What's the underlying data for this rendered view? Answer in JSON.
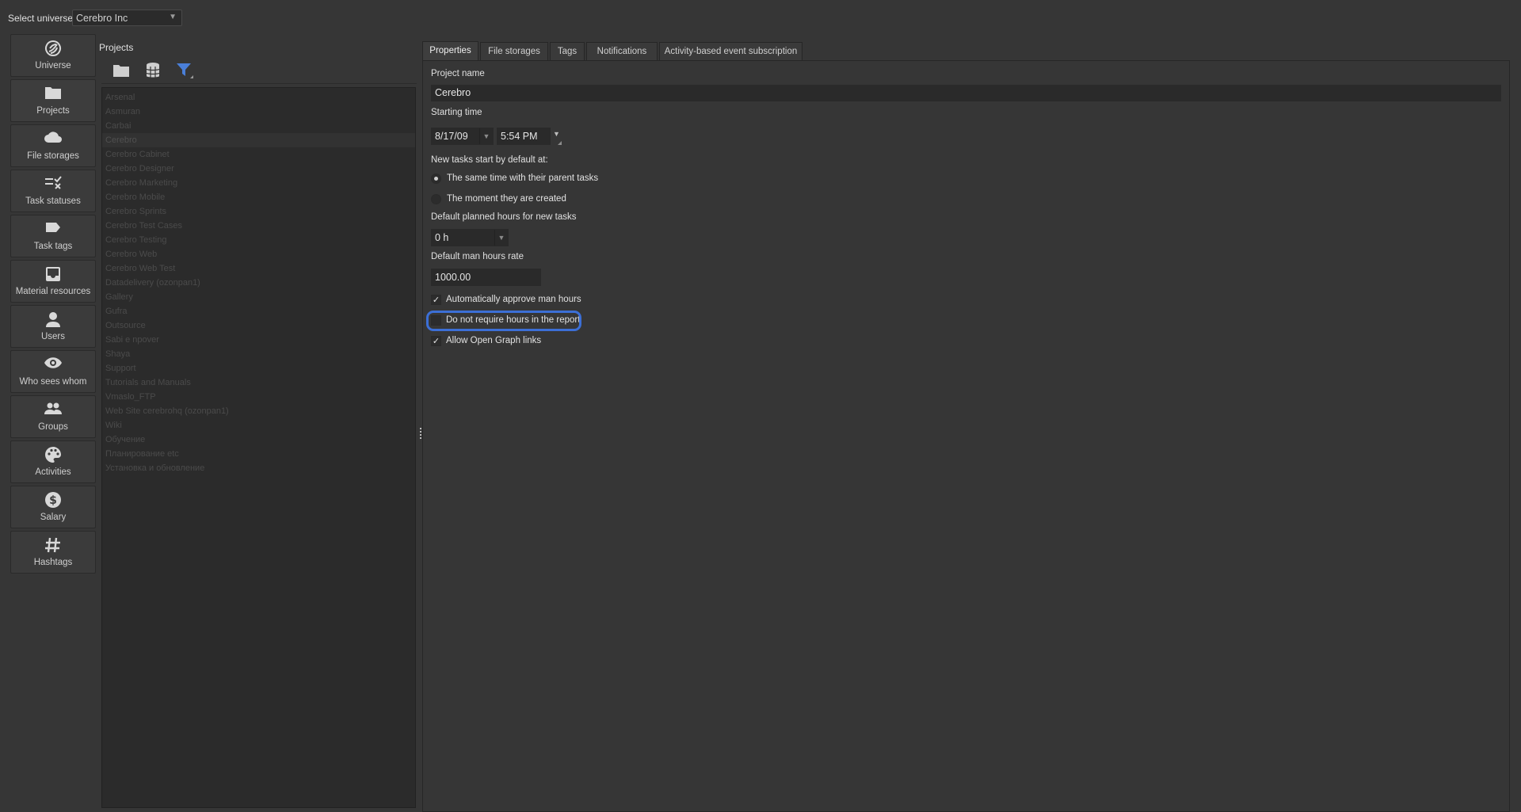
{
  "header": {
    "select_universe_label": "Select universe",
    "universe_value": "Cerebro Inc"
  },
  "sidebar": {
    "items": [
      {
        "label": "Universe",
        "icon": "universe-logo-icon"
      },
      {
        "label": "Projects",
        "icon": "folder-icon"
      },
      {
        "label": "File storages",
        "icon": "cloud-icon"
      },
      {
        "label": "Task statuses",
        "icon": "status-list-icon"
      },
      {
        "label": "Task tags",
        "icon": "tag-icon"
      },
      {
        "label": "Material resources",
        "icon": "inbox-icon"
      },
      {
        "label": "Users",
        "icon": "user-icon"
      },
      {
        "label": "Who sees whom",
        "icon": "eye-icon"
      },
      {
        "label": "Groups",
        "icon": "group-icon"
      },
      {
        "label": "Activities",
        "icon": "palette-icon"
      },
      {
        "label": "Salary",
        "icon": "dollar-icon"
      },
      {
        "label": "Hashtags",
        "icon": "hash-icon"
      }
    ],
    "active": "Projects"
  },
  "projects": {
    "title": "Projects",
    "toolbar": {
      "icons": [
        "folder-icon",
        "database-icon",
        "filter-icon"
      ],
      "accent": "#4a7fd8"
    },
    "items": [
      "Arsenal",
      "Asmuran",
      "Carbai",
      "Cerebro",
      "Cerebro Cabinet",
      "Cerebro Designer",
      "Cerebro Marketing",
      "Cerebro Mobile",
      "Cerebro Sprints",
      "Cerebro Test Cases",
      "Cerebro Testing",
      "Cerebro Web",
      "Cerebro Web Test",
      "Datadelivery (ozonpan1)",
      "Gallery",
      "Gufra",
      "Outsource",
      "Sabi e npover",
      "Shaya",
      "Support",
      "Tutorials and Manuals",
      "Vmaslo_FTP",
      "Web Site cerebrohq (ozonpan1)",
      "Wiki",
      "Обучение",
      "Планирование etc",
      "Установка и обновление"
    ],
    "selected": "Cerebro"
  },
  "tabs": [
    "Properties",
    "File storages",
    "Tags",
    "Notifications",
    "Activity-based event subscription"
  ],
  "active_tab": "Properties",
  "form": {
    "project_name_label": "Project name",
    "project_name_value": "Cerebro",
    "starting_time_label": "Starting time",
    "start_date": "8/17/09",
    "start_time": "5:54 PM",
    "new_tasks_label": "New tasks start by default at:",
    "radio_parent": "The same time with their parent tasks",
    "radio_created": "The moment they are created",
    "radio_selected": "parent",
    "planned_hours_label": "Default planned hours for new tasks",
    "planned_hours_value": "0 h",
    "man_hours_rate_label": "Default man hours rate",
    "man_hours_rate_value": "1000.00",
    "auto_approve_label": "Automatically approve man hours",
    "auto_approve_checked": true,
    "no_require_label": "Do not require hours in the report",
    "no_require_checked": false,
    "open_graph_label": "Allow Open Graph links",
    "open_graph_checked": true,
    "check_mark": "✓"
  },
  "colors": {
    "highlight": "#3c6fd6",
    "background": "#363636"
  }
}
